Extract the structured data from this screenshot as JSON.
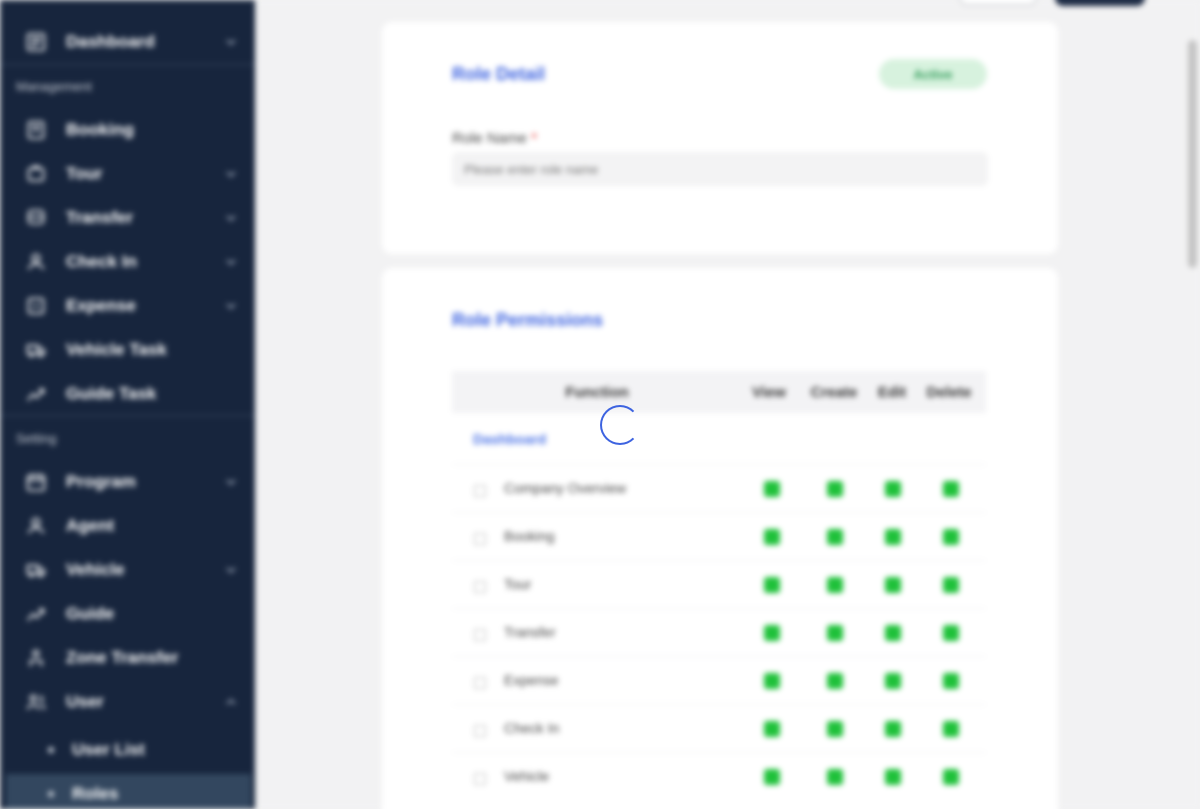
{
  "sidebar": {
    "dashboard": "Dashboard",
    "section_management": "Management",
    "management_items": [
      "Booking",
      "Tour",
      "Transfer",
      "Check In",
      "Expense",
      "Vehicle Task",
      "Guide Task"
    ],
    "section_setting": "Setting",
    "setting_items": [
      "Program",
      "Agent",
      "Vehicle",
      "Guide",
      "Zone Transfer",
      "User"
    ],
    "user_sub_items": [
      "User List",
      "Roles"
    ]
  },
  "role_detail": {
    "title": "Role Detail",
    "status": "Active",
    "name_label": "Role Name",
    "required_mark": "*",
    "name_placeholder": "Please enter role name"
  },
  "permissions": {
    "title": "Role Permissions",
    "columns": [
      "Function",
      "View",
      "Create",
      "Edit",
      "Delete"
    ],
    "group": "Dashboard",
    "rows": [
      "Company Overview",
      "Booking",
      "Tour",
      "Transfer",
      "Expense",
      "Check In",
      "Vehicle"
    ]
  },
  "colors": {
    "sidebar_bg": "#17253d",
    "accent": "#3d63e0",
    "check": "#1fc13a",
    "active_badge": "#2f9b58"
  }
}
